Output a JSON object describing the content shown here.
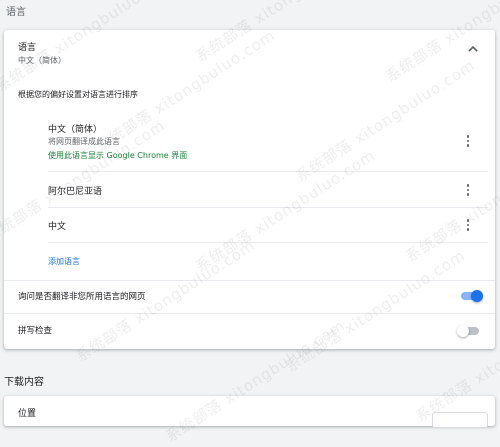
{
  "languages_section": {
    "title": "语言"
  },
  "language_card": {
    "header_label": "语言",
    "header_value": "中文（简体）",
    "order_hint": "根据您的偏好设置对语言进行排序",
    "languages": [
      {
        "name": "中文（简体）",
        "note": "将网页翻译成此语言",
        "display_note": "使用此语言显示 Google Chrome 界面"
      },
      {
        "name": "阿尔巴尼亚语"
      },
      {
        "name": "中文"
      }
    ],
    "add_language": "添加语言",
    "offer_translate_label": "询问是否翻译非您所用语言的网页",
    "offer_translate_enabled": true,
    "spell_check_label": "拼写检查",
    "spell_check_enabled": false
  },
  "downloads_section": {
    "title": "下载内容",
    "location_label": "位置"
  },
  "watermark_text": "系统部落 xitongbuluo.com",
  "colors": {
    "accent": "#1a73e8",
    "green_note": "#188038",
    "background": "#f1f3f4"
  }
}
